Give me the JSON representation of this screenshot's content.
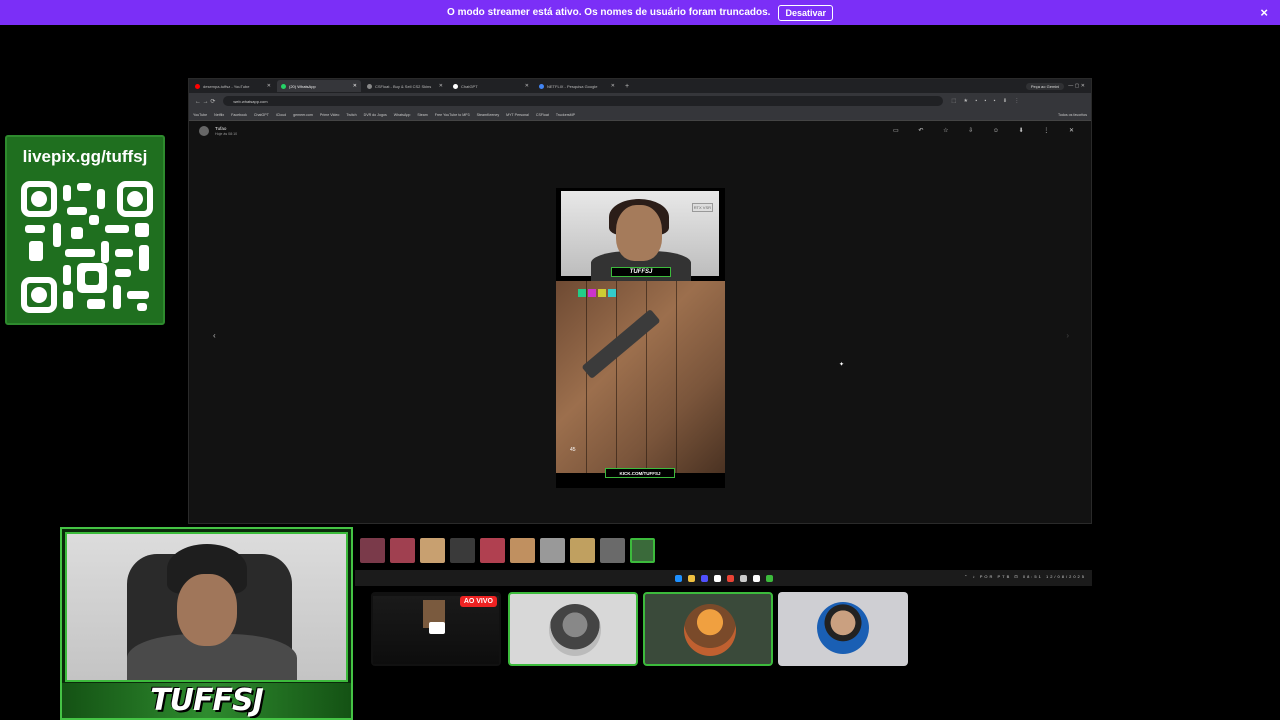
{
  "banner": {
    "message": "O modo streamer está ativo. Os nomes de usuário foram truncados.",
    "action_label": "Desativar",
    "close_icon": "×"
  },
  "browser": {
    "tabs": [
      {
        "label": "desempa‑tuffsz ‑ YouTube",
        "dot": "#ff0000",
        "active": false
      },
      {
        "label": "(20) WhatsApp",
        "dot": "#25d366",
        "active": true
      },
      {
        "label": "CSFloat ‑ Buy & Sell CS2 Skins",
        "dot": "#888888",
        "active": false
      },
      {
        "label": "ChatGPT",
        "dot": "#ffffff",
        "active": false
      },
      {
        "label": "NETFLIX ‑ Pesquisa Google",
        "dot": "#4285f4",
        "active": false
      }
    ],
    "new_tab": "+",
    "gemini_button": "Peça ao Gemini",
    "window_controls": "—  ▢  ✕",
    "nav_icons": "←  →  ⟳",
    "url": "web.whatsapp.com",
    "extension_icons": "⬚ ★ ▪ ▪ ▪ ⬇ ⋮",
    "bookmarks": [
      "YouTube",
      "Netflix",
      "Facebook",
      "ChatGPT",
      "iCloud",
      "gemeer.com",
      "Prime Video",
      "Twitch",
      "DVR do Jogos",
      "WhatsApp",
      "Steam",
      "Free YouTube to MP3",
      "SteamKeeney",
      "MYT Personal",
      "CSFloat",
      "TruckersMP"
    ],
    "all_bookmarks": "Todos os favoritos"
  },
  "viewer": {
    "sender_name": "Tufao",
    "sender_time": "Hoje às 08:10",
    "tool_icons": "▭ ↶ ☆ ⇩ ☺ ⬇ ⋮ ✕",
    "prev_arrow": "‹",
    "next_arrow": "›"
  },
  "media": {
    "cam_tag": "TUFFSJ",
    "rtx_badge": "RTX VSR",
    "ammo": "45",
    "kick_url": "KICK.COM/TUFFSJ"
  },
  "qr": {
    "title": "livepix.gg/tuffsj"
  },
  "webcam": {
    "brand": "TUFFSJ"
  },
  "thumbs": {
    "colors": [
      "#7a3a4a",
      "#a04050",
      "#c8a070",
      "#3a3a3a",
      "#b04050",
      "#c09060",
      "#999999",
      "#c0a060",
      "#6a6a6a",
      "#3a6a3a"
    ]
  },
  "taskbar": {
    "icons": [
      "#1e90ff",
      "#f0c040",
      "#5050ff",
      "#ffffff",
      "#ea4335",
      "#cccccc",
      "#ffffff",
      "#3cbb3c"
    ],
    "tray": "⌃ ♪ POR PTB ⊡ 08:51 12/08/2025"
  },
  "tiles": {
    "live_label": "AO VIVO"
  }
}
